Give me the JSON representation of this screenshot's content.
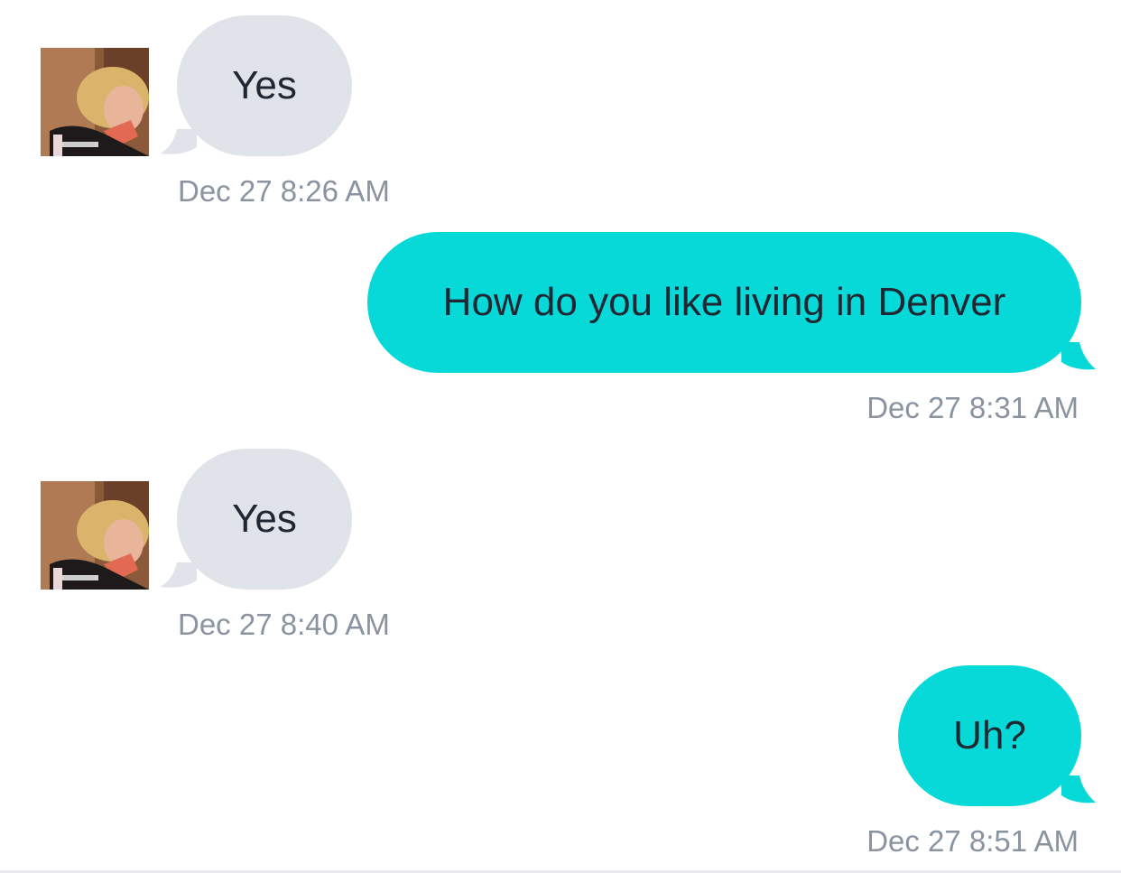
{
  "colors": {
    "incoming_bubble": "#e1e3ea",
    "outgoing_bubble": "#07d8d8",
    "timestamp": "#8a93a0",
    "message_text": "#1f2733"
  },
  "messages": [
    {
      "direction": "incoming",
      "text": "Yes",
      "timestamp": "Dec 27 8:26 AM",
      "avatar": "contact-photo"
    },
    {
      "direction": "outgoing",
      "text": "How do you like living in Denver",
      "timestamp": "Dec 27 8:31 AM"
    },
    {
      "direction": "incoming",
      "text": "Yes",
      "timestamp": "Dec 27 8:40 AM",
      "avatar": "contact-photo"
    },
    {
      "direction": "outgoing",
      "text": "Uh?",
      "timestamp": "Dec 27 8:51 AM"
    }
  ]
}
